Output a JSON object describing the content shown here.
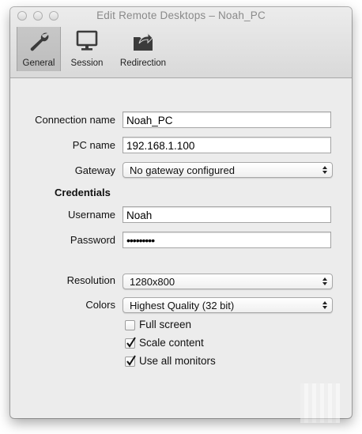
{
  "window": {
    "title": "Edit Remote Desktops – Noah_PC"
  },
  "tabs": [
    {
      "label": "General",
      "icon": "wrench-icon",
      "active": true
    },
    {
      "label": "Session",
      "icon": "monitor-icon",
      "active": false
    },
    {
      "label": "Redirection",
      "icon": "folder-redirect-icon",
      "active": false
    }
  ],
  "form": {
    "connection_name": {
      "label": "Connection name",
      "value": "Noah_PC"
    },
    "pc_name": {
      "label": "PC name",
      "value": "192.168.1.100"
    },
    "gateway": {
      "label": "Gateway",
      "value": "No gateway configured"
    },
    "credentials_heading": "Credentials",
    "username": {
      "label": "Username",
      "value": "Noah"
    },
    "password": {
      "label": "Password",
      "value": "•••••••••"
    },
    "resolution": {
      "label": "Resolution",
      "value": "1280x800"
    },
    "colors": {
      "label": "Colors",
      "value": "Highest Quality (32 bit)"
    },
    "checkboxes": [
      {
        "label": "Full screen",
        "checked": false
      },
      {
        "label": "Scale content",
        "checked": true
      },
      {
        "label": "Use all monitors",
        "checked": true
      }
    ]
  }
}
